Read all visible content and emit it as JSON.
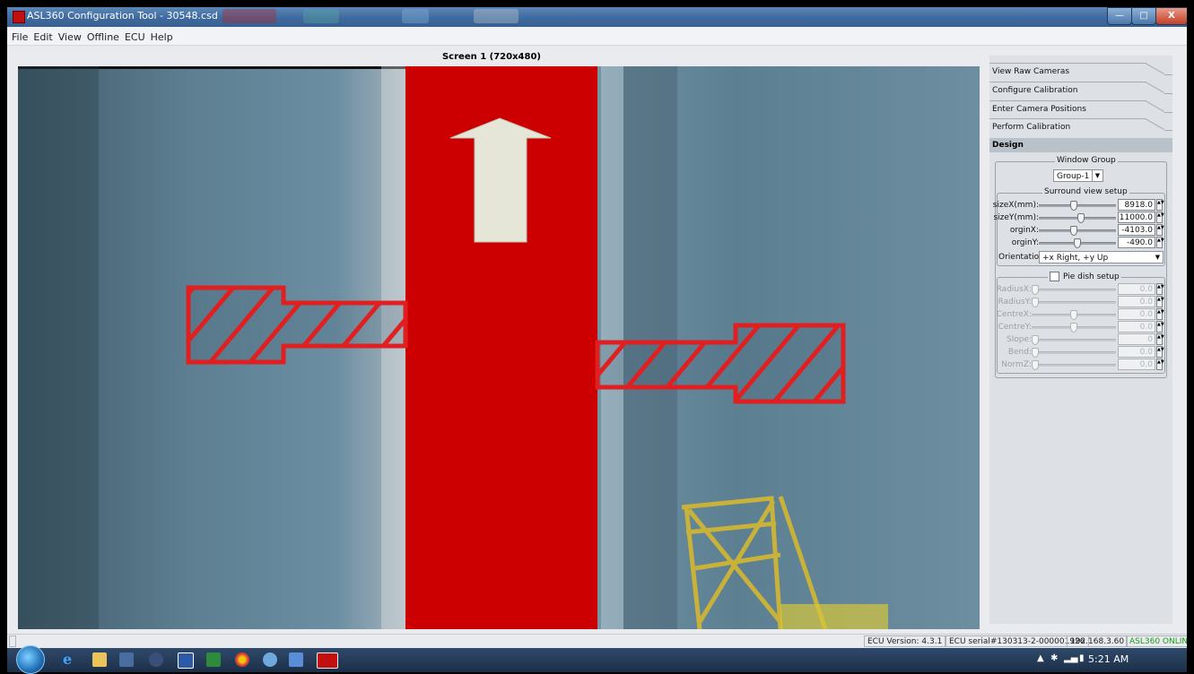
{
  "window": {
    "title": "ASL360 Configuration Tool - 30548.csd",
    "controls": {
      "minimize": "—",
      "maximize": "□",
      "close": "X"
    }
  },
  "menu": [
    "File",
    "Edit",
    "View",
    "Offline",
    "ECU",
    "Help"
  ],
  "screen_label": "Screen 1   (720x480)",
  "side_tabs": {
    "view_raw": "View Raw Cameras",
    "configure": "Configure Calibration",
    "enter_positions": "Enter Camera Positions",
    "perform": "Perform Calibration",
    "design": "Design"
  },
  "window_group": {
    "legend": "Window Group",
    "selected": "Group-1"
  },
  "surround": {
    "legend": "Surround view setup",
    "rows": [
      {
        "label": "sizeX(mm):",
        "value": "8918.0",
        "level": 0.45
      },
      {
        "label": "sizeY(mm):",
        "value": "11000.0",
        "level": 0.55
      },
      {
        "label": "orginX:",
        "value": "-4103.0",
        "level": 0.45
      },
      {
        "label": "orginY:",
        "value": "-490.0",
        "level": 0.5
      }
    ],
    "orientation_label": "Orientation:",
    "orientation_value": "+x Right, +y Up"
  },
  "pie": {
    "legend": "Pie dish setup",
    "rows": [
      {
        "label": "RadiusX:",
        "value": "0.0",
        "level": 0.0
      },
      {
        "label": "RadiusY:",
        "value": "0.0",
        "level": 0.0
      },
      {
        "label": "CentreX:",
        "value": "0.0",
        "level": 0.5
      },
      {
        "label": "CentreY:",
        "value": "0.0",
        "level": 0.5
      },
      {
        "label": "Slope:",
        "value": "0",
        "level": 0.0
      },
      {
        "label": "Bend:",
        "value": "0.0",
        "level": 0.0
      },
      {
        "label": "NormZ:",
        "value": "0.0",
        "level": 0.0
      }
    ]
  },
  "status": {
    "ecu_version": "ECU Version: 4.3.1",
    "ecu_serial": "ECU serial#130313-2-000001926",
    "ip": "192.168.3.60",
    "online": "ASL360 ONLINE"
  },
  "taskbar": {
    "clock": "5:21 AM"
  },
  "colors": {
    "overlay_red": "#cc0000",
    "arrow_fill": "#e6e6d8",
    "online_green": "#1a9a1a"
  }
}
